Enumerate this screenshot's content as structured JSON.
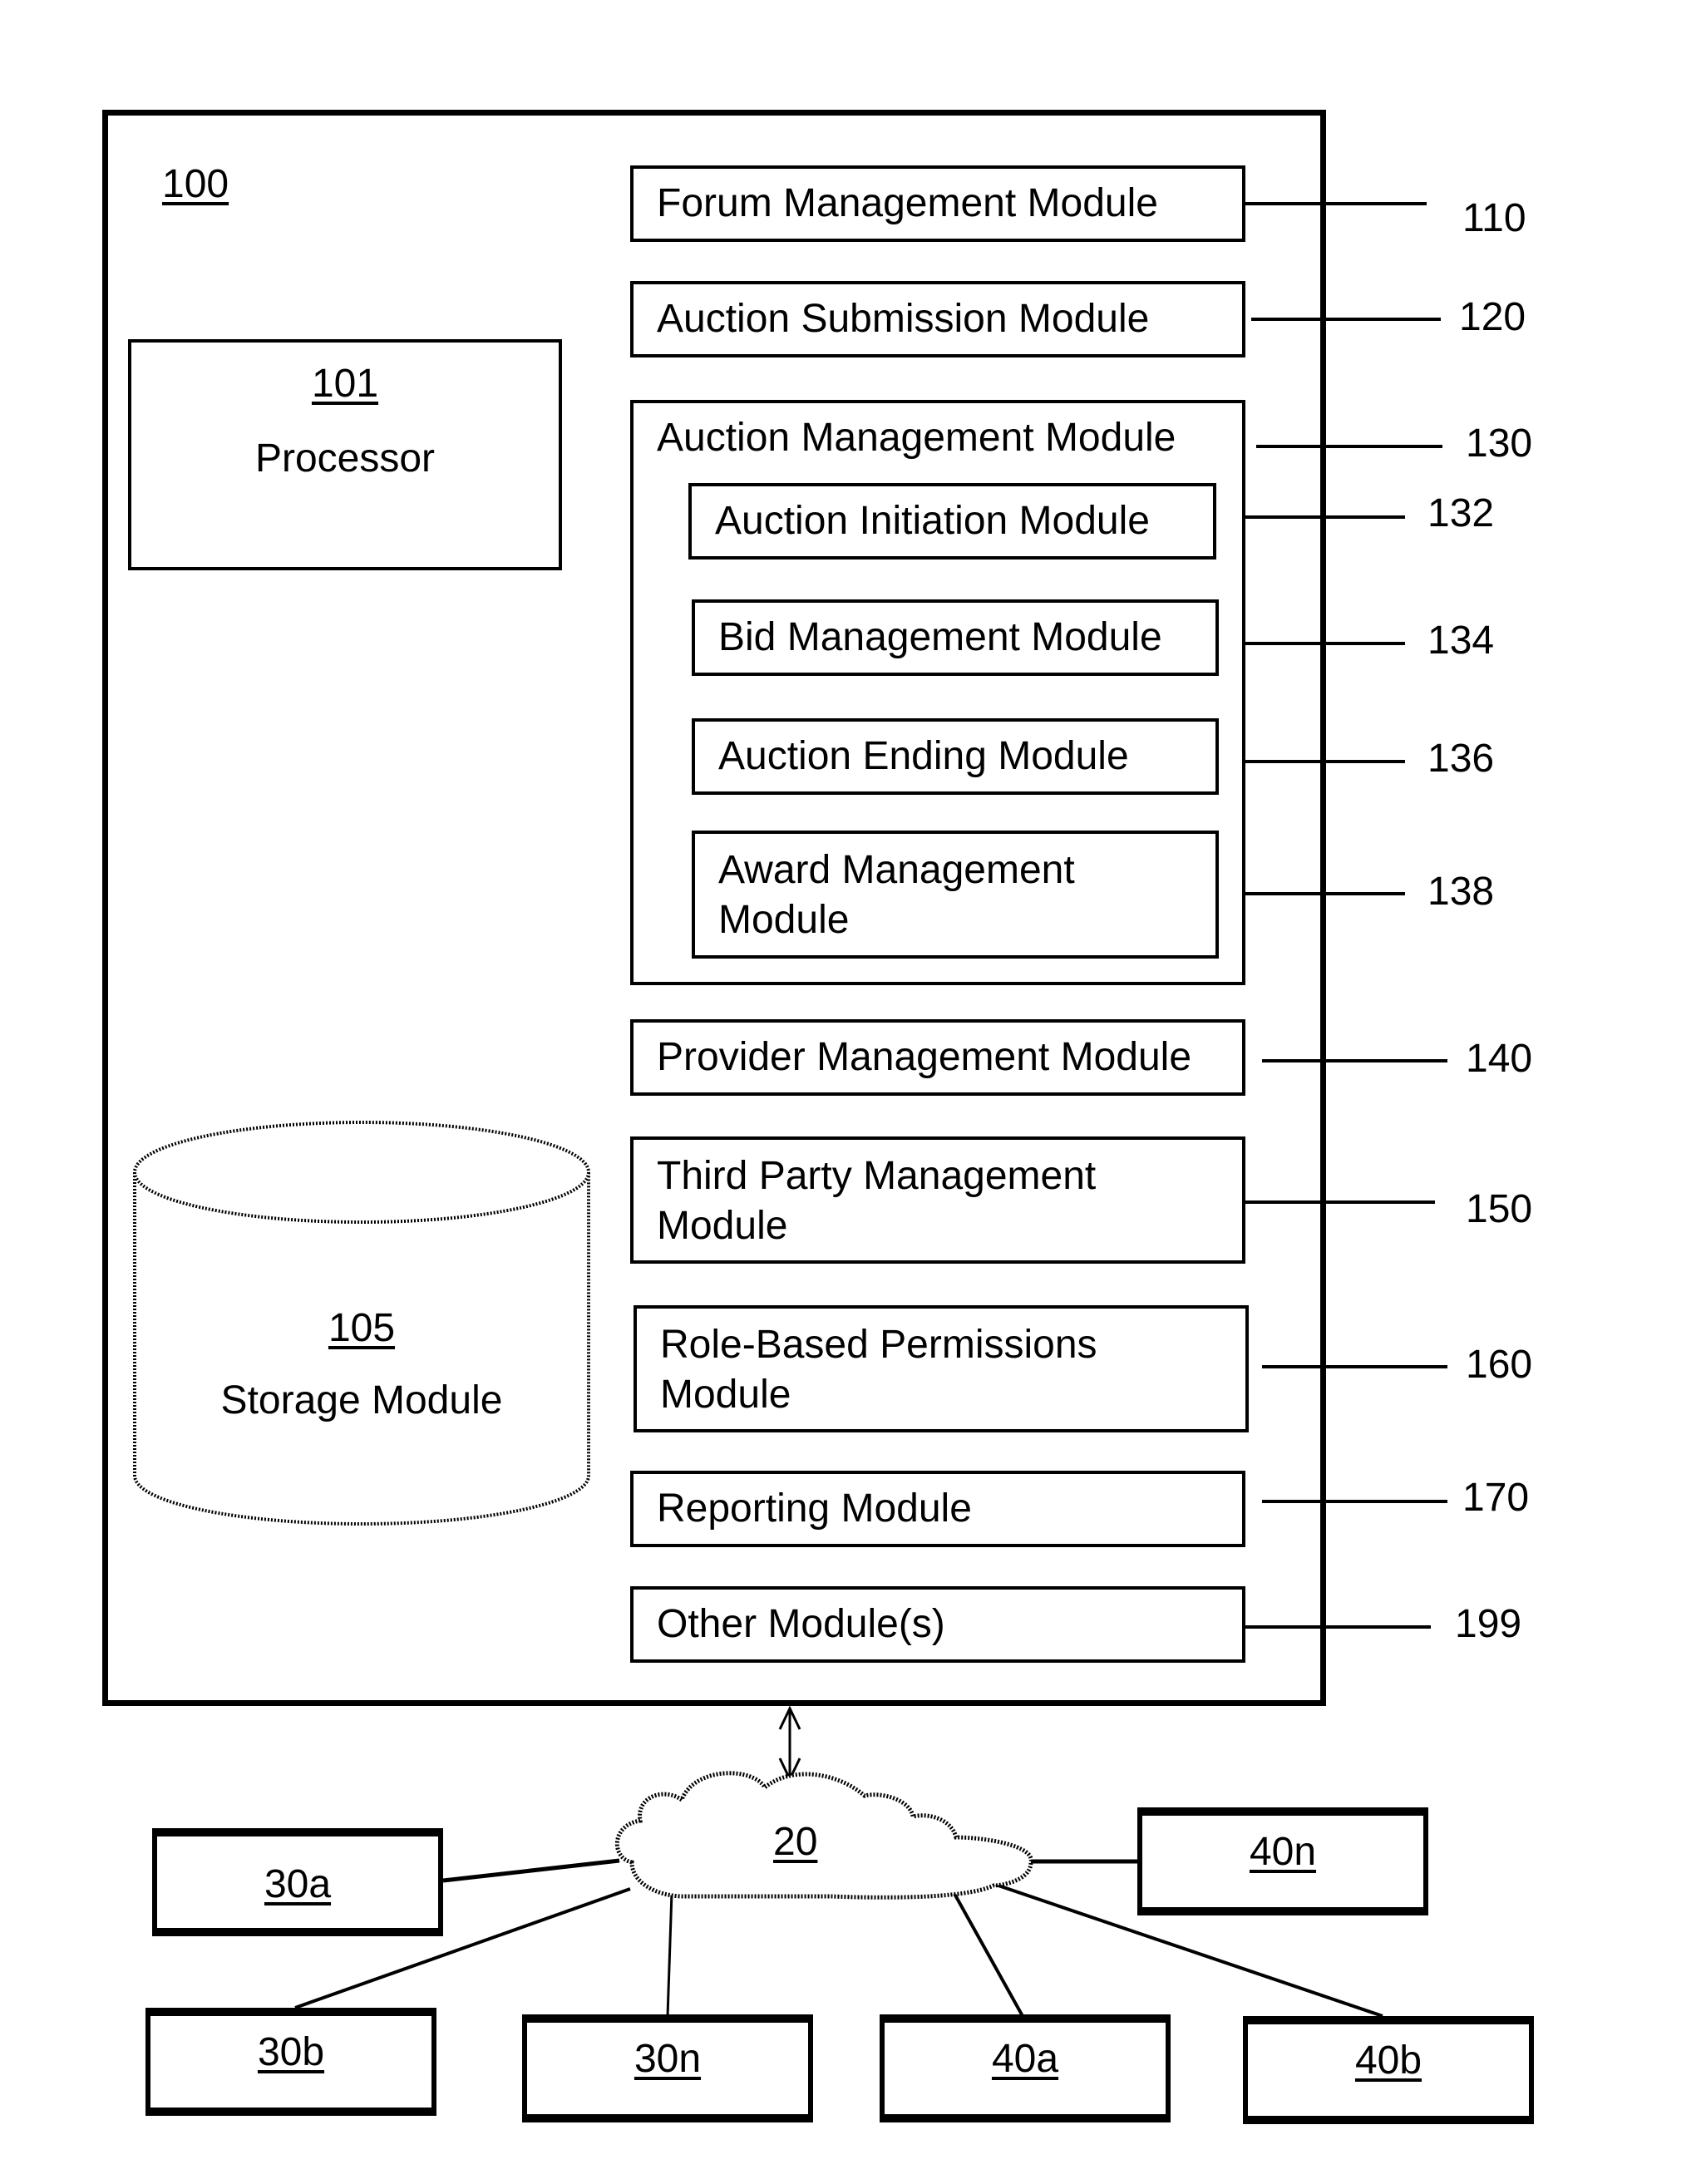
{
  "system": {
    "ref": "100"
  },
  "processor": {
    "ref": "101",
    "label": "Processor"
  },
  "storage": {
    "ref": "105",
    "label": "Storage Module"
  },
  "modules": [
    {
      "label": "Forum Management Module",
      "ref": "110"
    },
    {
      "label": "Auction Submission Module",
      "ref": "120"
    },
    {
      "label": "Auction Management Module",
      "ref": "130"
    },
    {
      "label": "Auction Initiation Module",
      "ref": "132"
    },
    {
      "label": "Bid Management Module",
      "ref": "134"
    },
    {
      "label": "Auction Ending Module",
      "ref": "136"
    },
    {
      "label": "Award Management Module",
      "ref": "138"
    },
    {
      "label": "Provider Management Module",
      "ref": "140"
    },
    {
      "label": "Third Party Management Module",
      "ref": "150"
    },
    {
      "label": "Role-Based Permissions Module",
      "ref": "160"
    },
    {
      "label": "Reporting Module",
      "ref": "170"
    },
    {
      "label": "Other Module(s)",
      "ref": "199"
    }
  ],
  "network": {
    "ref": "20"
  },
  "nodes": [
    "30a",
    "30b",
    "30n",
    "40a",
    "40b",
    "40n"
  ]
}
